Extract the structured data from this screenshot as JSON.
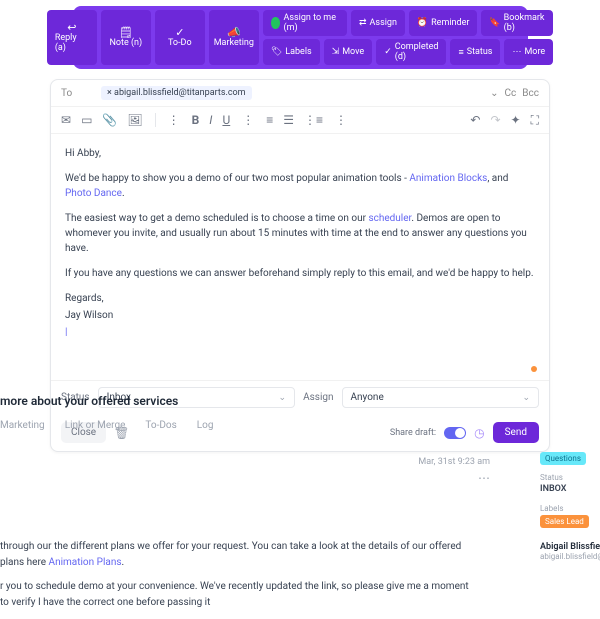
{
  "topbar": {
    "main": [
      {
        "icon": "↩",
        "label": "Reply (a)"
      },
      {
        "icon": "🗒",
        "label": "Note (n)"
      },
      {
        "icon": "✓",
        "label": "To-Do"
      },
      {
        "icon": "📣",
        "label": "Marketing"
      }
    ],
    "pills_row1": [
      {
        "icon": "avatar",
        "label": "Assign to me (m)"
      },
      {
        "icon": "⇄",
        "label": "Assign"
      },
      {
        "icon": "⏰",
        "label": "Reminder"
      },
      {
        "icon": "🔖",
        "label": "Bookmark (b)"
      }
    ],
    "pills_row2": [
      {
        "icon": "🏷",
        "label": "Labels"
      },
      {
        "icon": "⇲",
        "label": "Move"
      },
      {
        "icon": "✓",
        "label": "Completed (d)"
      },
      {
        "icon": "≡",
        "label": "Status"
      },
      {
        "icon": "⋯",
        "label": "More"
      }
    ]
  },
  "compose": {
    "to_label": "To",
    "chip_prefix": "×",
    "chip": "abigail.blissfield@titanparts.com",
    "cc": "Cc",
    "bcc": "Bcc"
  },
  "email": {
    "greeting": "Hi Abby,",
    "p1a": "We'd be happy to show you a demo of our two most popular animation tools - ",
    "link1": "Animation Blocks",
    "p1b": ", and ",
    "link2": "Photo Dance",
    "p1c": ".",
    "p2a": "The easiest way to get a demo scheduled is to choose a time on our ",
    "link3": "scheduler",
    "p2b": ". Demos are open to whomever you invite, and usually run about 15 minutes with time at the end to answer any questions you have.",
    "p3": "If you have any questions we can answer beforehand simply reply to this email, and we'd be happy to help.",
    "regards": "Regards,",
    "signature": "Jay Wilson"
  },
  "controls": {
    "status_label": "Status",
    "status_value": "Inbox",
    "assign_label": "Assign",
    "assign_value": "Anyone",
    "close": "Close",
    "share": "Share draft:",
    "send": "Send"
  },
  "lower": {
    "heading": "more about your offered services",
    "tabs": [
      "Marketing",
      "Link or Merge",
      "To-Dos",
      "Log"
    ],
    "timestamp": "Mar, 31st 9:23 am",
    "body1a": "through our the different plans we offer for your request. You can take a look at the details of our offered plans here ",
    "body1link": "Animation Plans",
    "body1b": ".",
    "body2": "r you to schedule demo at your convenience. We've recently updated the link, so please give me a moment to verify I have the correct one before passing it"
  },
  "side": {
    "tag1": "Questions",
    "status_lbl": "Status",
    "status_val": "INBOX",
    "labels_lbl": "Labels",
    "tag2": "Sales Lead",
    "name": "Abigail Blissfie",
    "email": "abigail.blissfield@"
  }
}
